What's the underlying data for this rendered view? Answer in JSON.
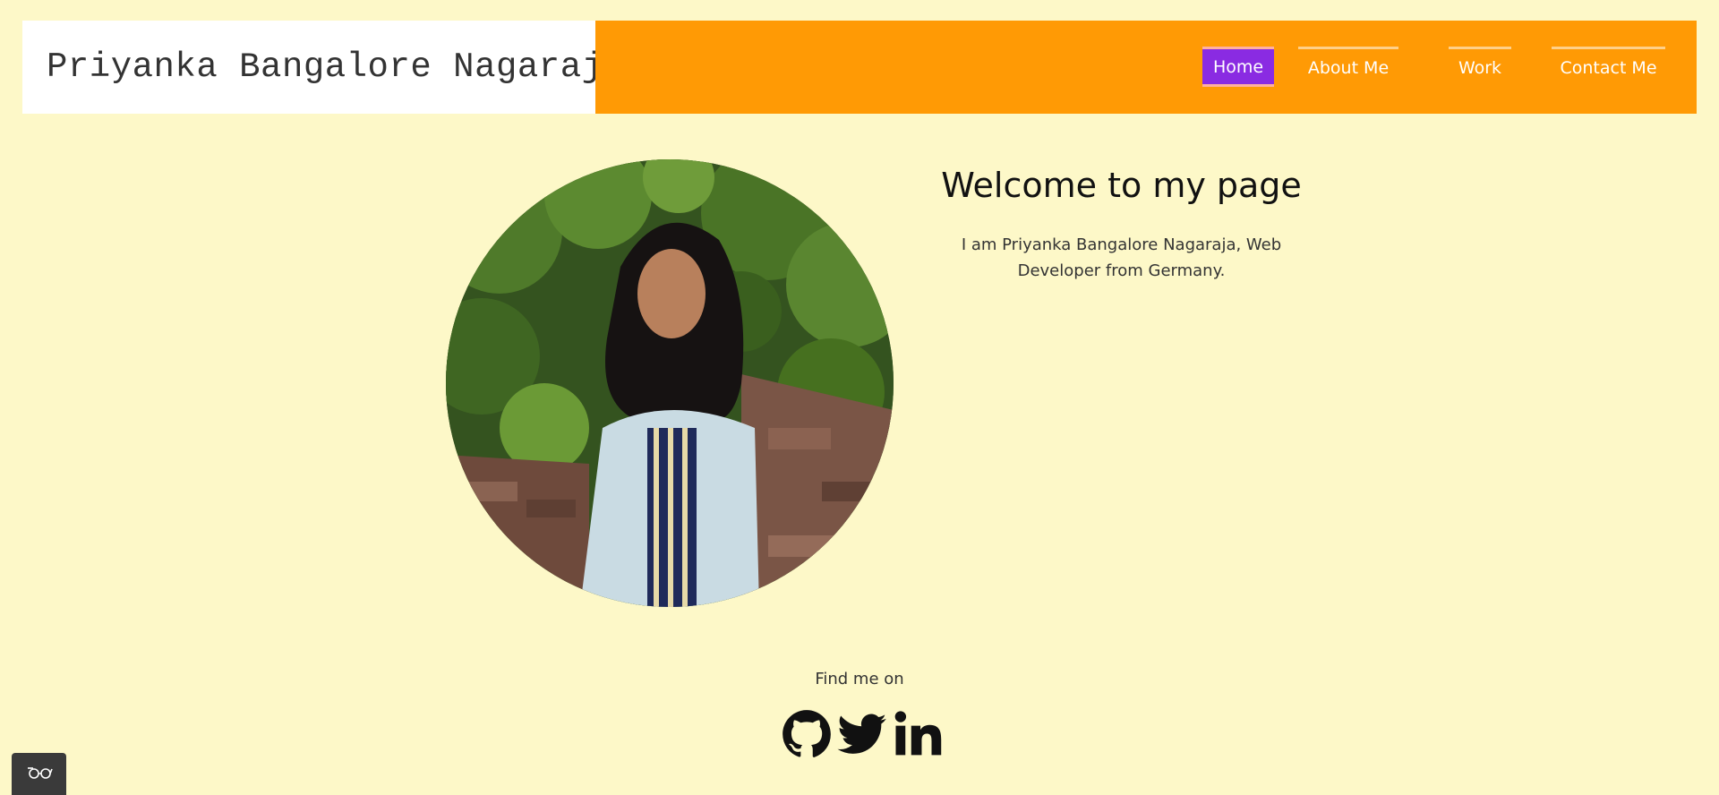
{
  "header": {
    "site_name": "Priyanka Bangalore Nagaraja",
    "nav": [
      {
        "label": "Home",
        "active": true
      },
      {
        "label": "About Me",
        "active": false
      },
      {
        "label": "Work",
        "active": false
      },
      {
        "label": "Contact Me",
        "active": false
      }
    ]
  },
  "welcome": {
    "title": "Welcome to my page",
    "text": "I am Priyanka Bangalore Nagaraja, Web Developer from Germany."
  },
  "footer": {
    "find_me_on": "Find me on",
    "socials": [
      {
        "icon": "github-icon"
      },
      {
        "icon": "twitter-icon"
      },
      {
        "icon": "linkedin-icon"
      }
    ]
  },
  "colors": {
    "background": "#fdf8c8",
    "navbar": "#ff9a05",
    "active_nav": "#8a2be2"
  }
}
